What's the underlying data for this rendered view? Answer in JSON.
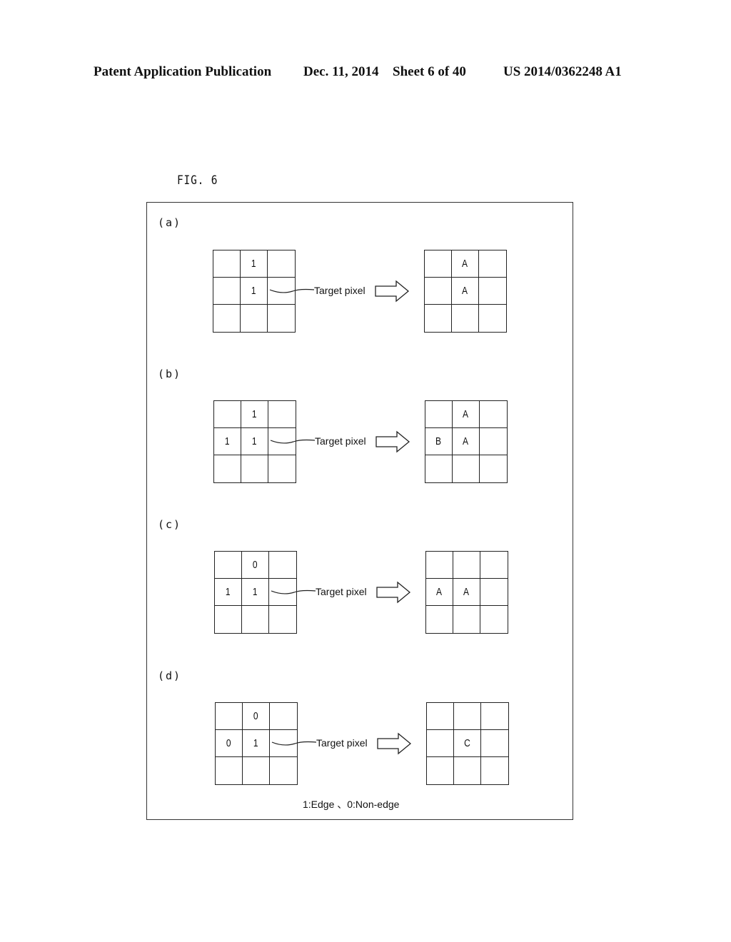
{
  "header": {
    "publication": "Patent Application Publication",
    "date": "Dec. 11, 2014",
    "sheet": "Sheet 6 of 40",
    "number": "US 2014/0362248 A1"
  },
  "figure": {
    "label": "FIG. 6",
    "target_label": "Target pixel",
    "legend": "1:Edge 、0:Non-edge",
    "panels": [
      {
        "label": "(a)",
        "input": [
          "",
          "1",
          "",
          "",
          "1",
          "",
          "",
          "",
          ""
        ],
        "output": [
          "",
          "A",
          "",
          "",
          "A",
          "",
          "",
          "",
          ""
        ]
      },
      {
        "label": "(b)",
        "input": [
          "",
          "1",
          "",
          "1",
          "1",
          "",
          "",
          "",
          ""
        ],
        "output": [
          "",
          "A",
          "",
          "B",
          "A",
          "",
          "",
          "",
          ""
        ]
      },
      {
        "label": "(c)",
        "input": [
          "",
          "0",
          "",
          "1",
          "1",
          "",
          "",
          "",
          ""
        ],
        "output": [
          "",
          "",
          "",
          "A",
          "A",
          "",
          "",
          "",
          ""
        ]
      },
      {
        "label": "(d)",
        "input": [
          "",
          "0",
          "",
          "0",
          "1",
          "",
          "",
          "",
          ""
        ],
        "output": [
          "",
          "",
          "",
          "",
          "C",
          "",
          "",
          "",
          ""
        ]
      }
    ]
  }
}
